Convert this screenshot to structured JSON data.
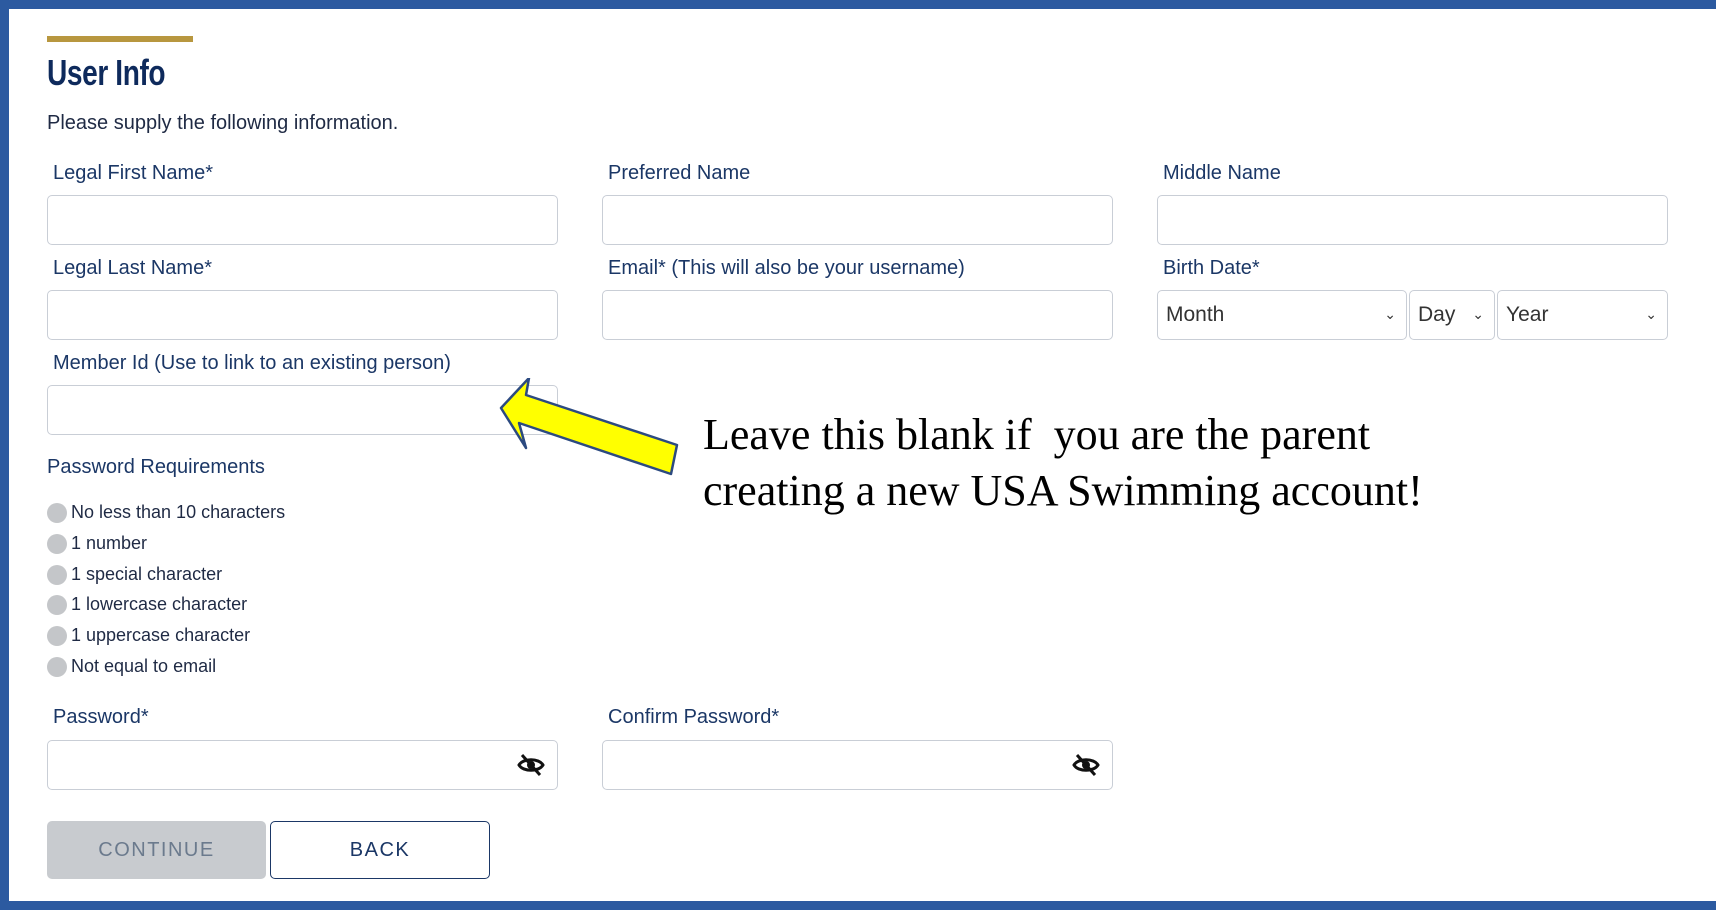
{
  "header": {
    "title": "User Info",
    "subtitle": "Please supply the following information."
  },
  "fields": {
    "first_name_label": "Legal First Name*",
    "preferred_name_label": "Preferred Name",
    "middle_name_label": "Middle Name",
    "last_name_label": "Legal Last Name*",
    "email_label": "Email* (This will also be your username)",
    "birth_date_label": "Birth Date*",
    "member_id_label": "Member Id (Use to link to an existing person)",
    "password_label": "Password*",
    "confirm_password_label": "Confirm Password*"
  },
  "birth_date": {
    "month": "Month",
    "day": "Day",
    "year": "Year"
  },
  "password_requirements": {
    "title": "Password Requirements",
    "items": [
      "No less than 10 characters",
      "1 number",
      "1 special character",
      "1 lowercase character",
      "1 uppercase character",
      "Not equal to email"
    ]
  },
  "buttons": {
    "continue": "CONTINUE",
    "back": "BACK"
  },
  "annotation": {
    "line1": "Leave this blank if  you are the parent",
    "line2": "creating a new USA Swimming account!"
  },
  "colors": {
    "frame": "#2c5aa0",
    "accent": "#b8973f",
    "navy": "#1b3766",
    "arrow_fill": "#ffff00"
  },
  "icons": {
    "password_toggle": "eye-slash-icon",
    "select_chevron": "chevron-down-icon"
  }
}
